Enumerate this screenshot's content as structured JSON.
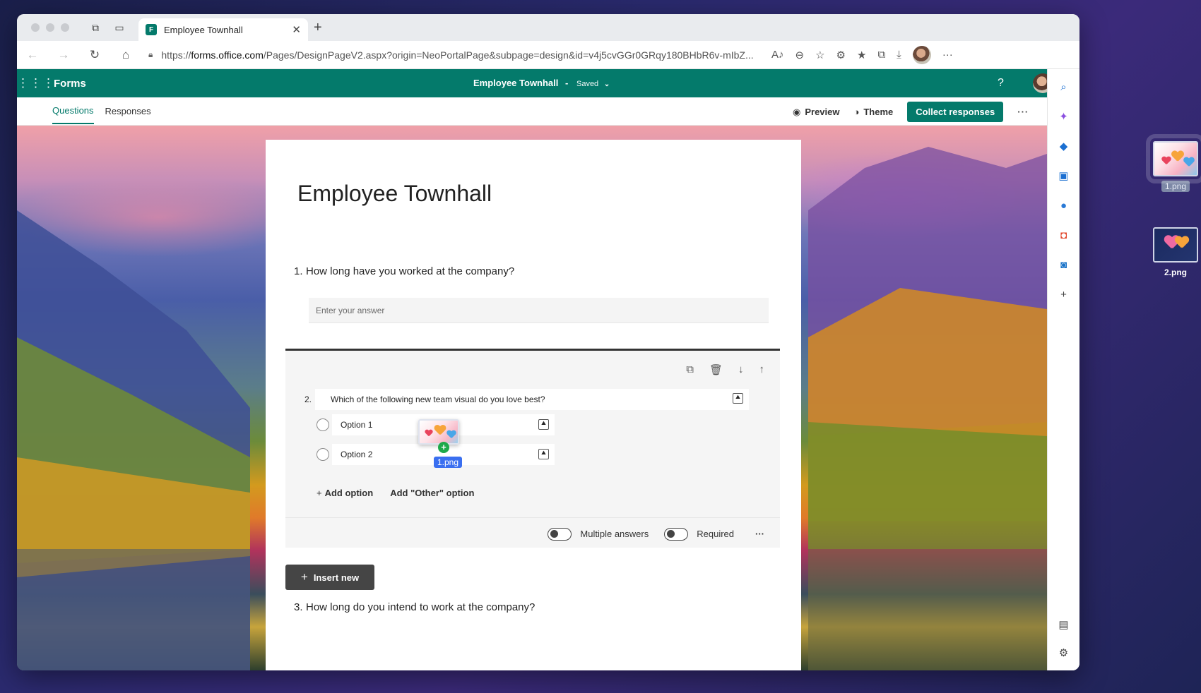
{
  "browser": {
    "tab_title": "Employee Townhall",
    "url_prefix": "https://",
    "url_domain": "forms.office.com",
    "url_rest": "/Pages/DesignPageV2.aspx?origin=NeoPortalPage&subpage=design&id=v4j5cvGGr0GRqy180BHbR6v-mIbZ..."
  },
  "forms_header": {
    "app_name": "Forms",
    "form_name": "Employee Townhall",
    "separator": "-",
    "save_status": "Saved"
  },
  "commandbar": {
    "tabs": [
      {
        "label": "Questions",
        "active": true
      },
      {
        "label": "Responses",
        "active": false
      }
    ],
    "preview_label": "Preview",
    "theme_label": "Theme",
    "collect_label": "Collect responses",
    "more_label": "···"
  },
  "form": {
    "title": "Employee Townhall",
    "questions": [
      {
        "number": "1.",
        "text": "How long have you worked at the company?",
        "placeholder": "Enter your answer"
      },
      {
        "number": "2.",
        "text": "Which of the following new team visual do you love best?",
        "options": [
          "Option 1",
          "Option 2"
        ],
        "add_option": "Add option",
        "add_other": "Add \"Other\" option",
        "multiple_answers": "Multiple answers",
        "required": "Required"
      },
      {
        "number": "3.",
        "text": "How long do you intend to work at the company?"
      }
    ],
    "insert_new": "Insert new"
  },
  "drag": {
    "file_label": "1.png"
  },
  "desktop_files": [
    {
      "name": "1.png",
      "selected": true
    },
    {
      "name": "2.png",
      "selected": false
    }
  ],
  "colors": {
    "brand": "#047a6b",
    "collect_bg": "#047a6b",
    "drag_label_bg": "#3a6ff0"
  }
}
